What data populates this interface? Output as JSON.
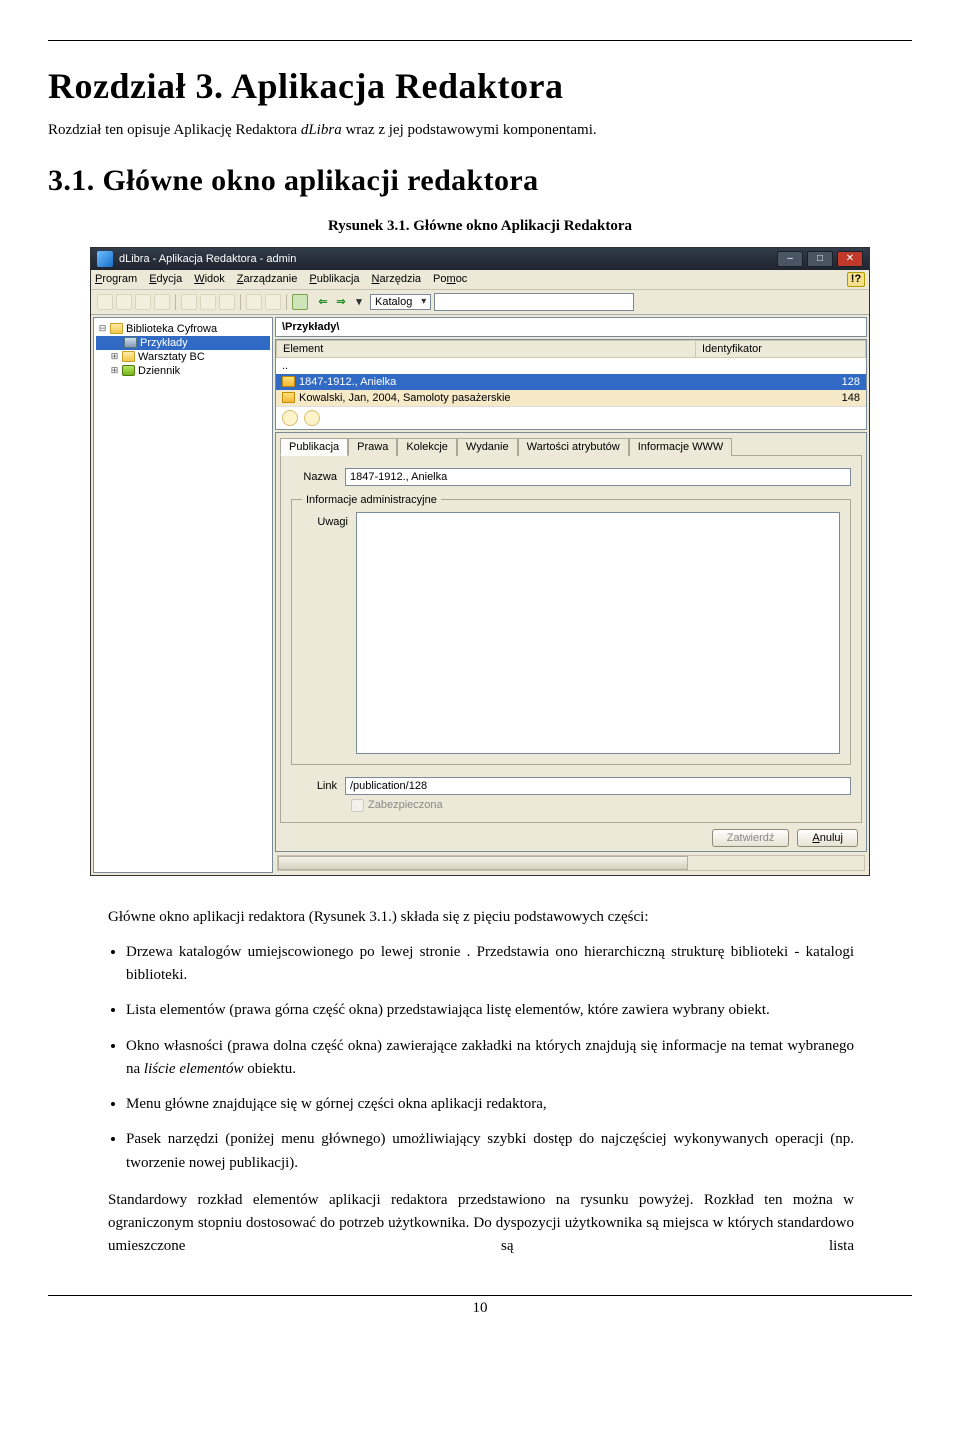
{
  "heading": "Rozdział 3. Aplikacja Redaktora",
  "intro_part1": "Rozdział ten opisuje Aplikację Redaktora ",
  "intro_em": "dLibra",
  "intro_part2": " wraz z jej podstawowymi komponentami.",
  "subheading": "3.1. Główne okno aplikacji redaktora",
  "figure_caption": "Rysunek 3.1. Główne okno Aplikacji Redaktora",
  "screenshot": {
    "title": "dLibra - Aplikacja Redaktora - admin",
    "menu": [
      "Program",
      "Edycja",
      "Widok",
      "Zarządzanie",
      "Publikacja",
      "Narzędzia",
      "Pomoc"
    ],
    "menu_underline_idx": [
      0,
      0,
      0,
      0,
      0,
      0,
      2
    ],
    "help_glyph": "!?",
    "catalog_label": "Katalog",
    "tree": {
      "root": "Biblioteka Cyfrowa",
      "selected": "Przykłady",
      "items": [
        "Warsztaty BC",
        "Dziennik"
      ]
    },
    "path": "\\Przykłady\\",
    "list": {
      "columns": [
        "Element",
        "Identyfikator"
      ],
      "dots": "..",
      "rows": [
        {
          "name": "1847-1912., Anielka",
          "id": "128",
          "selected": true
        },
        {
          "name": "Kowalski, Jan, 2004, Samoloty pasażerskie",
          "id": "148",
          "selected": false
        }
      ]
    },
    "tabs": [
      "Publikacja",
      "Prawa",
      "Kolekcje",
      "Wydanie",
      "Wartości atrybutów",
      "Informacje WWW"
    ],
    "active_tab": 0,
    "form": {
      "nazwa_label": "Nazwa",
      "nazwa_value": "1847-1912., Anielka",
      "adm_legend": "Informacje administracyjne",
      "uwagi_label": "Uwagi",
      "link_label": "Link",
      "link_value": "/publication/128",
      "zabezpieczona": "Zabezpieczona"
    },
    "buttons": {
      "zatwierdz": "Zatwierdź",
      "anuluj": "Anuluj"
    }
  },
  "after_fig": "Główne okno aplikacji redaktora (Rysunek 3.1.) składa się z pięciu podstawowych części:",
  "bullets": [
    {
      "text": "Drzewa katalogów umiejscowionego po lewej stronie . Przedstawia ono hierarchiczną strukturę biblioteki - katalogi biblioteki."
    },
    {
      "text": "Lista elementów (prawa górna część okna) przedstawiająca listę elementów, które zawiera wybrany obiekt."
    },
    {
      "text_pre": "Okno własności (prawa dolna część okna) zawierające zakładki na których znajdują się informacje na temat wybranego na ",
      "em": "liście elementów",
      "text_post": " obiektu."
    },
    {
      "text": "Menu główne znajdujące się w górnej części okna aplikacji redaktora,"
    },
    {
      "text": "Pasek narzędzi (poniżej menu głównego) umożliwiający szybki dostęp do najczęściej wykonywanych operacji (np. tworzenie nowej publikacji)."
    }
  ],
  "after_list": "Standardowy rozkład elementów aplikacji redaktora przedstawiono na rysunku powyżej. Rozkład ten można w ograniczonym stopniu dostosować do potrzeb użytkownika. Do dyspozycji użytkownika są miejsca w których standardowo umieszczone są lista",
  "page_number": "10"
}
